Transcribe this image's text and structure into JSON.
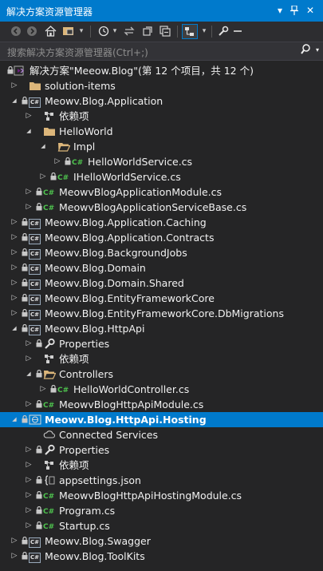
{
  "window": {
    "title": "解决方案资源管理器"
  },
  "search": {
    "placeholder": "搜索解决方案资源管理器(Ctrl+;)"
  },
  "tree": {
    "solution_label": "解决方案\"Meeow.Blog\"(第 12 个项目，共 12 个)",
    "rows": [
      {
        "label": "solution-items",
        "level": 1,
        "expander": "collapsed",
        "icon": "folder"
      },
      {
        "label": "Meowv.Blog.Application",
        "level": 1,
        "expander": "expanded",
        "icon": "csproj",
        "lock": true
      },
      {
        "label": "依赖项",
        "level": 2,
        "expander": "collapsed",
        "icon": "dependencies"
      },
      {
        "label": "HelloWorld",
        "level": 2,
        "expander": "expanded",
        "icon": "folder"
      },
      {
        "label": "Impl",
        "level": 3,
        "expander": "expanded",
        "icon": "folder-open"
      },
      {
        "label": "HelloWorldService.cs",
        "level": 4,
        "expander": "collapsed",
        "icon": "csharp",
        "lock": true
      },
      {
        "label": "IHelloWorldService.cs",
        "level": 3,
        "expander": "collapsed",
        "icon": "csharp",
        "lock": true
      },
      {
        "label": "MeowvBlogApplicationModule.cs",
        "level": 2,
        "expander": "collapsed",
        "icon": "csharp",
        "lock": true
      },
      {
        "label": "MeowvBlogApplicationServiceBase.cs",
        "level": 2,
        "expander": "collapsed",
        "icon": "csharp",
        "lock": true
      },
      {
        "label": "Meowv.Blog.Application.Caching",
        "level": 1,
        "expander": "collapsed",
        "icon": "csproj",
        "lock": true
      },
      {
        "label": "Meowv.Blog.Application.Contracts",
        "level": 1,
        "expander": "collapsed",
        "icon": "csproj",
        "lock": true
      },
      {
        "label": "Meowv.Blog.BackgroundJobs",
        "level": 1,
        "expander": "collapsed",
        "icon": "csproj",
        "lock": true
      },
      {
        "label": "Meowv.Blog.Domain",
        "level": 1,
        "expander": "collapsed",
        "icon": "csproj",
        "lock": true
      },
      {
        "label": "Meowv.Blog.Domain.Shared",
        "level": 1,
        "expander": "collapsed",
        "icon": "csproj",
        "lock": true
      },
      {
        "label": "Meowv.Blog.EntityFrameworkCore",
        "level": 1,
        "expander": "collapsed",
        "icon": "csproj",
        "lock": true
      },
      {
        "label": "Meowv.Blog.EntityFrameworkCore.DbMigrations",
        "level": 1,
        "expander": "collapsed",
        "icon": "csproj",
        "lock": true
      },
      {
        "label": "Meowv.Blog.HttpApi",
        "level": 1,
        "expander": "expanded",
        "icon": "csproj",
        "lock": true
      },
      {
        "label": "Properties",
        "level": 2,
        "expander": "collapsed",
        "icon": "wrench",
        "lock": true
      },
      {
        "label": "依赖项",
        "level": 2,
        "expander": "collapsed",
        "icon": "dependencies"
      },
      {
        "label": "Controllers",
        "level": 2,
        "expander": "expanded",
        "icon": "folder-open",
        "lock": true
      },
      {
        "label": "HelloWorldController.cs",
        "level": 3,
        "expander": "collapsed",
        "icon": "csharp",
        "lock": true
      },
      {
        "label": "MeowvBlogHttpApiModule.cs",
        "level": 2,
        "expander": "collapsed",
        "icon": "csharp",
        "lock": true
      },
      {
        "label": "Meowv.Blog.HttpApi.Hosting",
        "level": 1,
        "expander": "expanded",
        "icon": "webproj",
        "lock": true,
        "selected": true
      },
      {
        "label": "Connected Services",
        "level": 2,
        "expander": "none",
        "icon": "cloud"
      },
      {
        "label": "Properties",
        "level": 2,
        "expander": "collapsed",
        "icon": "wrench",
        "lock": true
      },
      {
        "label": "依赖项",
        "level": 2,
        "expander": "collapsed",
        "icon": "dependencies"
      },
      {
        "label": "appsettings.json",
        "level": 2,
        "expander": "collapsed",
        "icon": "json",
        "lock": true
      },
      {
        "label": "MeowvBlogHttpApiHostingModule.cs",
        "level": 2,
        "expander": "collapsed",
        "icon": "csharp",
        "lock": true
      },
      {
        "label": "Program.cs",
        "level": 2,
        "expander": "collapsed",
        "icon": "csharp",
        "lock": true
      },
      {
        "label": "Startup.cs",
        "level": 2,
        "expander": "collapsed",
        "icon": "csharp",
        "lock": true
      },
      {
        "label": "Meowv.Blog.Swagger",
        "level": 1,
        "expander": "collapsed",
        "icon": "csproj",
        "lock": true
      },
      {
        "label": "Meowv.Blog.ToolKits",
        "level": 1,
        "expander": "collapsed",
        "icon": "csproj",
        "lock": true
      }
    ]
  },
  "colors": {
    "accent": "#007acc",
    "background": "#252526",
    "csharp": "#4ec24e",
    "folder": "#dcb67a"
  }
}
